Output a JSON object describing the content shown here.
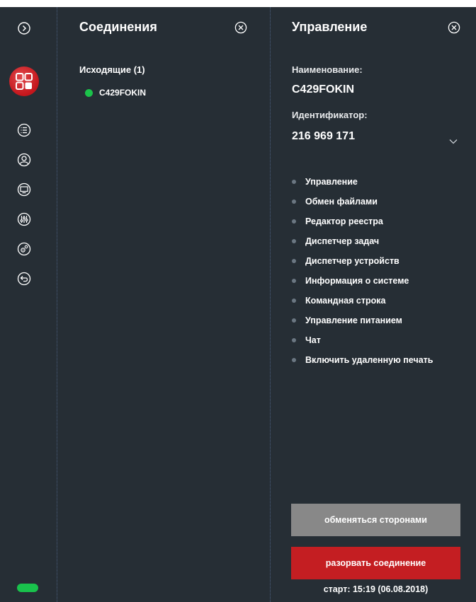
{
  "connections": {
    "title": "Соединения",
    "outgoing_label": "Исходящие (1)",
    "items": [
      {
        "name": "C429FOKIN",
        "status": "online",
        "status_color": "#1bc34a"
      }
    ]
  },
  "control": {
    "title": "Управление",
    "name_label": "Наименование:",
    "name_value": "C429FOKIN",
    "id_label": "Идентификатор:",
    "id_value": "216 969 171",
    "actions": [
      "Управление",
      "Обмен файлами",
      "Редактор реестра",
      "Диспетчер задач",
      "Диспетчер устройств",
      "Информация о системе",
      "Командная строка",
      "Управление питанием",
      "Чат",
      "Включить удаленную печать"
    ],
    "swap_button": "обменяться сторонами",
    "disconnect_button": "разорвать соединение",
    "start_text": "старт: 15:19 (06.08.2018)"
  },
  "sidebar": {
    "icons": [
      "expand-icon",
      "apps-icon",
      "list-icon",
      "contacts-icon",
      "monitor-icon",
      "equalizer-icon",
      "settings-icon",
      "back-icon"
    ],
    "status_indicator": "online"
  },
  "colors": {
    "background": "#262e35",
    "accent_red": "#c41e22",
    "status_green": "#19c24c",
    "button_gray": "#888888"
  }
}
